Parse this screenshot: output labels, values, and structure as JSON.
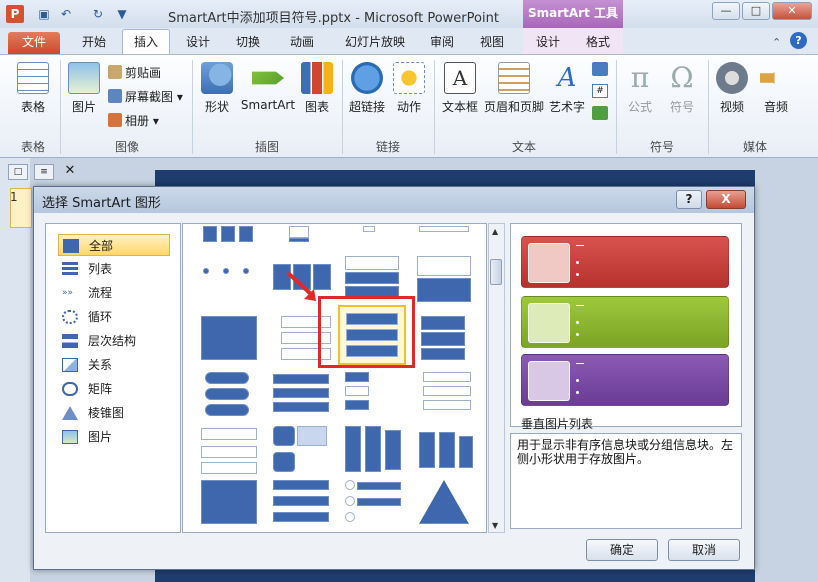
{
  "window": {
    "title": "SmartArt中添加项目符号.pptx - Microsoft PowerPoint",
    "tools_tab": "SmartArt 工具",
    "app_icon": "P"
  },
  "tabs": [
    "文件",
    "开始",
    "插入",
    "设计",
    "切换",
    "动画",
    "幻灯片放映",
    "审阅",
    "视图",
    "设计",
    "格式"
  ],
  "ribbon": {
    "table": {
      "label": "表格",
      "group": "表格"
    },
    "picture": {
      "label": "图片"
    },
    "clipart": {
      "label": "剪贴画"
    },
    "screenshot": {
      "label": "屏幕截图"
    },
    "album": {
      "label": "相册"
    },
    "image_group": "图像",
    "shapes": {
      "label": "形状"
    },
    "smartart": {
      "label": "SmartArt"
    },
    "chart": {
      "label": "图表"
    },
    "illustration_group": "插图",
    "hyperlink": {
      "label": "超链接"
    },
    "action": {
      "label": "动作"
    },
    "link_group": "链接",
    "textbox": {
      "label": "文本框"
    },
    "header_footer": {
      "label": "页眉和页脚"
    },
    "wordart": {
      "label": "艺术字"
    },
    "text_group": "文本",
    "formula": {
      "label": "公式"
    },
    "symbol": {
      "label": "符号"
    },
    "symbol_group": "符号",
    "video": {
      "label": "视频"
    },
    "audio": {
      "label": "音频"
    },
    "media_group": "媒体"
  },
  "slide_panel": {
    "number": "1"
  },
  "dialog": {
    "title": "选择 SmartArt 图形",
    "help": "?",
    "close": "X",
    "categories": [
      "全部",
      "列表",
      "流程",
      "循环",
      "层次结构",
      "关系",
      "矩阵",
      "棱锥图",
      "图片"
    ],
    "selected_name": "垂直图片列表",
    "description": "用于显示非有序信息块或分组信息块。左侧小形状用于存放图片。",
    "ok": "确定",
    "cancel": "取消"
  },
  "colors": {
    "preview_red": "#c9403a",
    "preview_green": "#8fb431",
    "preview_purple": "#7b4aa4",
    "highlight": "#e02a2a"
  }
}
